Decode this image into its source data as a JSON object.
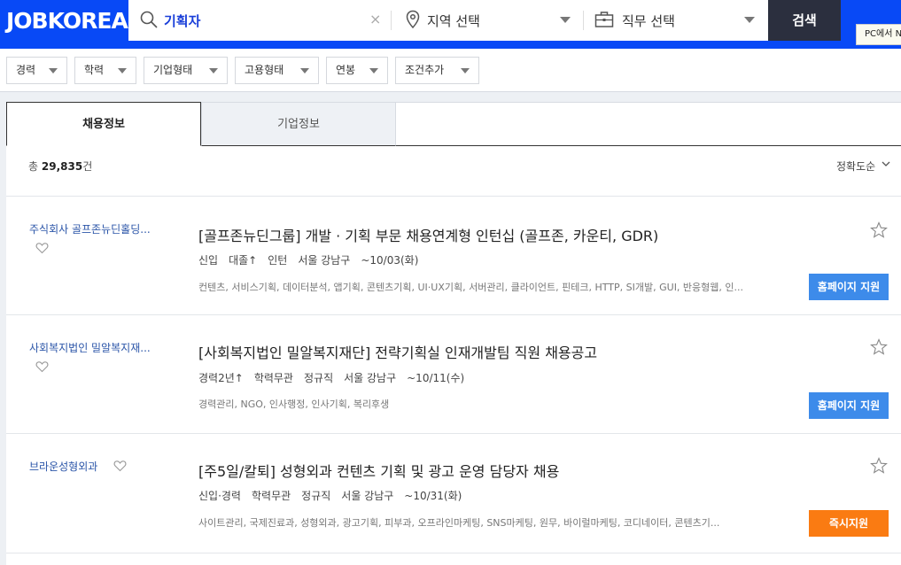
{
  "header": {
    "logo": "JOBKOREA",
    "search_keyword": "기획자",
    "clear_glyph": "×",
    "region_label": "지역 선택",
    "job_label": "직무 선택",
    "search_button": "검색",
    "tooltip": "PC에서 N"
  },
  "filters": [
    "경력",
    "학력",
    "기업형태",
    "고용형태",
    "연봉",
    "조건추가"
  ],
  "tabs": {
    "jobs": "채용정보",
    "companies": "기업정보"
  },
  "results": {
    "count_prefix": "총",
    "count": "29,835",
    "count_suffix": "건",
    "sort": "정확도순"
  },
  "listings": [
    {
      "company": "주식회사 골프존뉴딘홀딩...",
      "title": "[골프존뉴딘그룹] 개발 · 기획 부문 채용연계형 인턴십 (골프존, 카운티, GDR)",
      "meta": [
        "신입",
        "대졸↑",
        "인턴",
        "서울 강남구",
        "~10/03(화)"
      ],
      "tags": "컨텐츠, 서비스기획, 데이터분석, 앱기획, 콘텐츠기획, UI·UX기획, 서버관리, 클라이언트, 핀테크, HTTP, SI개발, GUI, 반응형웹, 인...",
      "apply": "홈페이지 지원"
    },
    {
      "company": "사회복지법인 밀알복지재...",
      "title": "[사회복지법인 밀알복지재단] 전략기획실 인재개발팀 직원 채용공고",
      "meta": [
        "경력2년↑",
        "학력무관",
        "정규직",
        "서울 강남구",
        "~10/11(수)"
      ],
      "tags": "경력관리, NGO, 인사행정, 인사기획, 복리후생",
      "apply": "홈페이지 지원"
    },
    {
      "company": "브라운성형외과",
      "title": "[주5일/칼퇴] 성형외과 컨텐츠 기획 및 광고 운영 담당자 채용",
      "meta": [
        "신입·경력",
        "학력무관",
        "정규직",
        "서울 강남구",
        "~10/31(화)"
      ],
      "tags": "사이트관리, 국제진료과, 성형외과, 광고기획, 피부과, 오프라인마케팅, SNS마케팅, 원무, 바이럴마케팅, 코디네이터, 콘텐츠기...",
      "apply": "즉시지원"
    }
  ],
  "colors": {
    "brand": "#0849f6",
    "apply_blue": "#3d8bea",
    "apply_orange": "#fa7b12"
  }
}
